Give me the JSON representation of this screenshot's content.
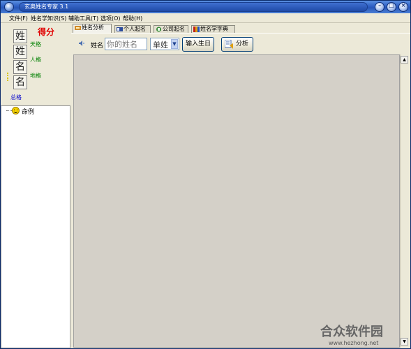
{
  "window": {
    "title": "玄奥姓名专家 3.1",
    "controls": [
      "minimize",
      "maximize",
      "close"
    ]
  },
  "menu": [
    {
      "label": "文件(F)"
    },
    {
      "label": "姓名学知识(S)"
    },
    {
      "label": "辅助工具(T)"
    },
    {
      "label": "选项(O)"
    },
    {
      "label": "帮助(H)"
    }
  ],
  "left_panel": {
    "name_chars": [
      "姓",
      "姓",
      "名",
      "名"
    ],
    "score_label": "得分",
    "ge": {
      "tian": "天格",
      "ren": "人格",
      "di": "地格",
      "zong": "总格"
    },
    "tree": {
      "item": "命例"
    }
  },
  "tabs": [
    {
      "label": "姓名分析",
      "icon": "analysis-icon",
      "active": true
    },
    {
      "label": "个人起名",
      "icon": "person-card-icon",
      "active": false
    },
    {
      "label": "公司起名",
      "icon": "company-icon",
      "active": false
    },
    {
      "label": "姓名学字典",
      "icon": "book-icon",
      "active": false
    }
  ],
  "toolbar": {
    "name_label": "姓名",
    "name_placeholder": "你的姓名",
    "surname_select": "单姓",
    "birthday_button": "输入生日",
    "analyze_button": "分析"
  },
  "watermark": {
    "name": "合众软件园",
    "site": "www.hezhong.net"
  },
  "colors": {
    "title_bar": "#2d5fc4",
    "score_red": "#e00000",
    "ge_green": "#008000",
    "zongge_blue": "#0000cc",
    "main_bg": "#d4d0c8"
  }
}
